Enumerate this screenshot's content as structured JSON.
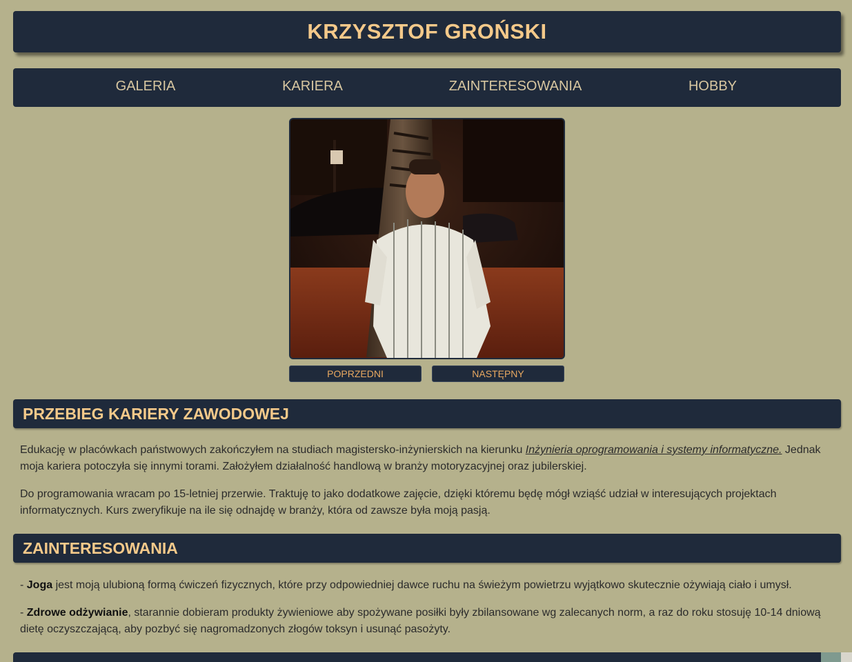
{
  "header": {
    "title": "KRZYSZTOF GROŃSKI"
  },
  "nav": {
    "items": [
      {
        "label": "GALERIA"
      },
      {
        "label": "KARIERA"
      },
      {
        "label": "ZAINTERESOWANIA"
      },
      {
        "label": "HOBBY"
      }
    ]
  },
  "gallery": {
    "prev_label": "POPRZEDNI",
    "next_label": "NASTĘPNY"
  },
  "career": {
    "heading": "PRZEBIEG KARIERY ZAWODOWEJ",
    "p1_before": "Edukację w placówkach państwowych zakończyłem na studiach magistersko-inżynierskich na kierunku ",
    "p1_link": "Inżynieria oprogramowania i systemy informatyczne.",
    "p1_after": " Jednak moja kariera potoczyła się innymi torami. Założyłem działalność handlową w branży motoryzacyjnej oraz jubilerskiej.",
    "p2": "Do programowania wracam po 15-letniej przerwie. Traktuję to jako dodatkowe zajęcie, dzięki któremu będę mógł wziąść udział w interesujących projektach informatycznych. Kurs zweryfikuje na ile się odnajdę w branży, która od zawsze była moją pasją."
  },
  "interests": {
    "heading": "ZAINTERESOWANIA",
    "item1_prefix": "- ",
    "item1_bold": "Joga",
    "item1_text": " jest moją ulubioną formą ćwiczeń fizycznych, które przy odpowiedniej dawce ruchu na świeżym powietrzu wyjątkowo skutecznie ożywiają ciało i umysł.",
    "item2_prefix": "- ",
    "item2_bold": "Zdrowe odżywianie",
    "item2_text": ", starannie dobieram produkty żywieniowe aby spożywane posiłki były zbilansowane wg zalecanych norm, a raz do roku stosuję 10-14 dniową dietę oczyszczającą, aby pozbyć się nagromadzonych złogów toksyn i usunąć pasożyty."
  }
}
